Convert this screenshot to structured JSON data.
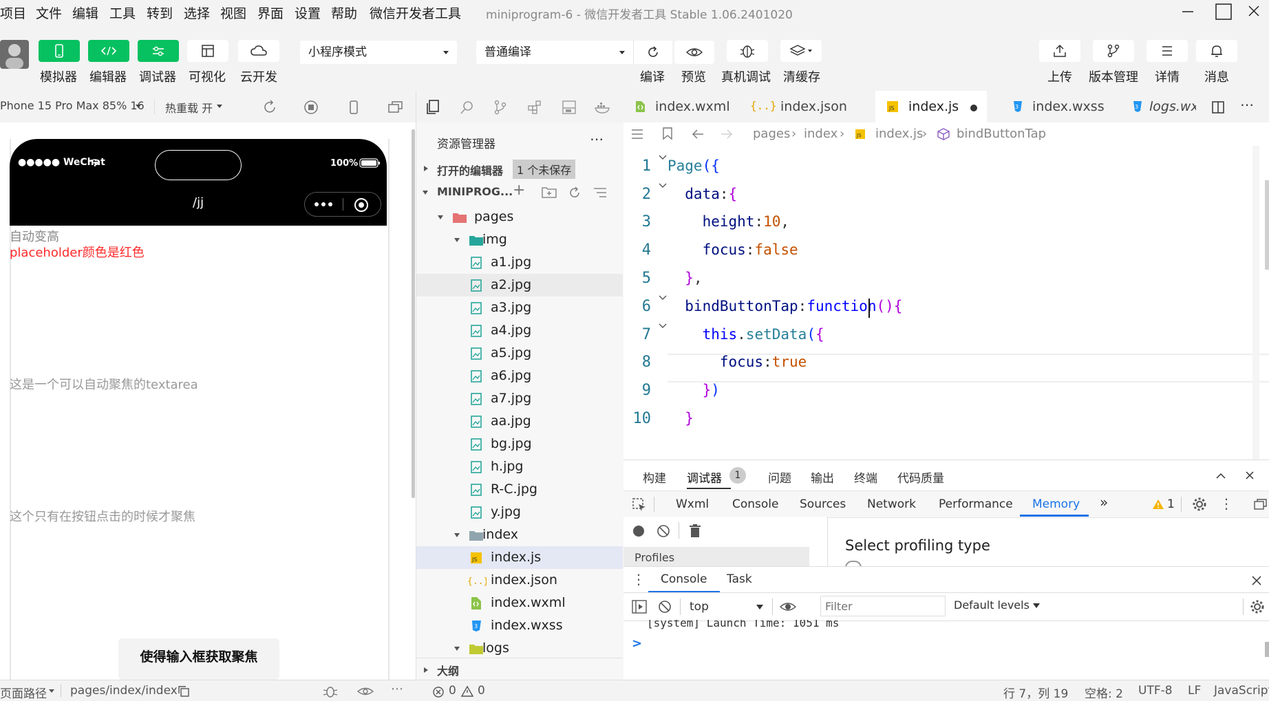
{
  "menubar": {
    "items": [
      "项目",
      "文件",
      "编辑",
      "工具",
      "转到",
      "选择",
      "视图",
      "界面",
      "设置",
      "帮助",
      "微信开发者工具"
    ],
    "window_title": "miniprogram-6 - 微信开发者工具 Stable 1.06.2401020"
  },
  "toolbar": {
    "buttons": [
      {
        "label": "模拟器",
        "icon": "phone-icon"
      },
      {
        "label": "编辑器",
        "icon": "code-icon"
      },
      {
        "label": "调试器",
        "icon": "debug-icon"
      },
      {
        "label": "可视化",
        "icon": "layout-icon"
      },
      {
        "label": "云开发",
        "icon": "cloud-icon"
      }
    ],
    "mode_select": "小程序模式",
    "compile_select": "普通编译",
    "right_buttons": [
      {
        "label": "编译",
        "icon": "refresh-icon"
      },
      {
        "label": "预览",
        "icon": "eye-icon"
      },
      {
        "label": "真机调试",
        "icon": "bug-icon"
      },
      {
        "label": "清缓存",
        "icon": "layers-icon"
      },
      {
        "label": "上传",
        "icon": "upload-icon"
      },
      {
        "label": "版本管理",
        "icon": "branch-icon"
      },
      {
        "label": "详情",
        "icon": "menu-icon"
      },
      {
        "label": "消息",
        "icon": "bell-icon"
      }
    ]
  },
  "simulator": {
    "device": "Phone 15 Pro Max 85% 16",
    "hot_reload": "热重载 开",
    "status_left": "●●●●● WeChat",
    "battery": "100%",
    "nav_title": "/jj",
    "texts": {
      "auto_height": "自动变高",
      "placeholder_red": "placeholder颜色是红色",
      "autofocus": "这是一个可以自动聚焦的textarea",
      "button_focus": "这个只有在按钮点击的时候才聚焦",
      "button_label": "使得输入框获取聚焦"
    }
  },
  "explorer": {
    "title": "资源管理器",
    "open_editors": "打开的编辑器",
    "unsaved_badge": "1 个未保存",
    "project": "MINIPROG...",
    "tree": [
      {
        "label": "pages",
        "type": "folder-open",
        "depth": 1
      },
      {
        "label": "img",
        "type": "folder-open",
        "depth": 2
      },
      {
        "label": "a1.jpg",
        "type": "image",
        "depth": 3
      },
      {
        "label": "a2.jpg",
        "type": "image",
        "depth": 3
      },
      {
        "label": "a3.jpg",
        "type": "image",
        "depth": 3
      },
      {
        "label": "a4.jpg",
        "type": "image",
        "depth": 3
      },
      {
        "label": "a5.jpg",
        "type": "image",
        "depth": 3
      },
      {
        "label": "a6.jpg",
        "type": "image",
        "depth": 3
      },
      {
        "label": "a7.jpg",
        "type": "image",
        "depth": 3
      },
      {
        "label": "aa.jpg",
        "type": "image",
        "depth": 3
      },
      {
        "label": "bg.jpg",
        "type": "image",
        "depth": 3
      },
      {
        "label": "h.jpg",
        "type": "image",
        "depth": 3
      },
      {
        "label": "R-C.jpg",
        "type": "image",
        "depth": 3
      },
      {
        "label": "y.jpg",
        "type": "image",
        "depth": 3
      },
      {
        "label": "index",
        "type": "folder-open",
        "depth": 2
      },
      {
        "label": "index.js",
        "type": "js",
        "depth": 3
      },
      {
        "label": "index.json",
        "type": "json",
        "depth": 3
      },
      {
        "label": "index.wxml",
        "type": "wxml",
        "depth": 3
      },
      {
        "label": "index.wxss",
        "type": "wxss",
        "depth": 3
      },
      {
        "label": "logs",
        "type": "folder-open",
        "depth": 2
      }
    ],
    "outline": "大纲"
  },
  "editor": {
    "tabs": [
      {
        "label": "index.wxml",
        "type": "wxml"
      },
      {
        "label": "index.json",
        "type": "json"
      },
      {
        "label": "index.js",
        "type": "js"
      },
      {
        "label": "index.wxss",
        "type": "wxss"
      },
      {
        "label": "logs.wx",
        "type": "wxss"
      }
    ],
    "breadcrumb": [
      "pages",
      "index",
      "index.js",
      "bindButtonTap"
    ],
    "line_numbers": [
      "1",
      "2",
      "3",
      "4",
      "5",
      "6",
      "7",
      "8",
      "9",
      "10"
    ],
    "code_lines": [
      [
        {
          "t": "Page",
          "c": "#267f99"
        },
        {
          "t": "({",
          "c": "#0431fa"
        }
      ],
      [
        {
          "t": "  data",
          "c": "#001080"
        },
        {
          "t": ":",
          "c": "#333"
        },
        {
          "t": "{",
          "c": "#af00db"
        }
      ],
      [
        {
          "t": "    height",
          "c": "#001080"
        },
        {
          "t": ":",
          "c": "#333"
        },
        {
          "t": "10",
          "c": "#c45100"
        },
        {
          "t": ",",
          "c": "#333"
        }
      ],
      [
        {
          "t": "    focus",
          "c": "#001080"
        },
        {
          "t": ":",
          "c": "#333"
        },
        {
          "t": "false",
          "c": "#c45100"
        }
      ],
      [
        {
          "t": "  }",
          "c": "#af00db"
        },
        {
          "t": ",",
          "c": "#333"
        }
      ],
      [
        {
          "t": "  bindButtonTap",
          "c": "#001080"
        },
        {
          "t": ":",
          "c": "#333"
        },
        {
          "t": "function",
          "c": "#0000ff"
        },
        {
          "t": "(){",
          "c": "#af00db"
        }
      ],
      [
        {
          "t": "    this",
          "c": "#0000ff"
        },
        {
          "t": ".",
          "c": "#333"
        },
        {
          "t": "setData",
          "c": "#267f99"
        },
        {
          "t": "(",
          "c": "#0431fa"
        },
        {
          "t": "{",
          "c": "#af00db"
        }
      ],
      [
        {
          "t": "      focus",
          "c": "#001080"
        },
        {
          "t": ":",
          "c": "#333"
        },
        {
          "t": "true",
          "c": "#c45100"
        }
      ],
      [
        {
          "t": "    }",
          "c": "#af00db"
        },
        {
          "t": ")",
          "c": "#0431fa"
        }
      ],
      [
        {
          "t": "  }",
          "c": "#af00db"
        }
      ]
    ]
  },
  "debugger": {
    "top_tabs": [
      "构建",
      "调试器",
      "问题",
      "输出",
      "终端",
      "代码质量"
    ],
    "debugger_badge": "1",
    "devtools_tabs": [
      "Wxml",
      "Console",
      "Sources",
      "Network",
      "Performance",
      "Memory"
    ],
    "warning_count": "1",
    "memory_sidebar": "Profiles",
    "select_profiling": "Select profiling type",
    "drawer_tabs": [
      "Console",
      "Task"
    ],
    "context": "top",
    "filter_placeholder": "Filter",
    "levels": "Default levels",
    "console_line": "[system] Launch Time: 1051 ms",
    "prompt": ">"
  },
  "statusbar": {
    "page_path_label": "页面路径",
    "page_path": "pages/index/index",
    "errors": "0",
    "warnings": "0",
    "cursor": "行 7，列 19",
    "spaces": "空格: 2",
    "encoding": "UTF-8",
    "eol": "LF",
    "language": "JavaScript"
  },
  "colors": {
    "green": "#07c160",
    "active_blue": "#1a73e8",
    "red_text": "#ff2a2a"
  }
}
